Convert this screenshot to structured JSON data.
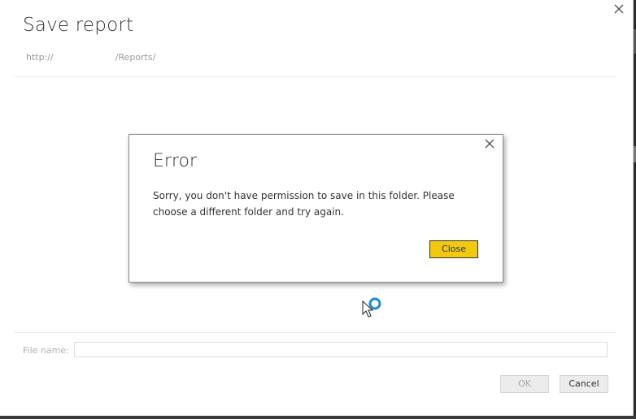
{
  "dialog": {
    "title": "Save report",
    "path_prefix": "http://",
    "path_suffix": "/Reports/",
    "close_icon": "close-icon",
    "filename_label": "File name:",
    "filename_value": "",
    "ok_label": "OK",
    "cancel_label": "Cancel"
  },
  "error": {
    "title": "Error",
    "message": "Sorry, you don't have permission to save in this folder. Please choose a different folder and try again.",
    "close_label": "Close",
    "close_icon": "close-icon",
    "accent_color": "#f2c811"
  },
  "cursor": {
    "icon": "busy-cursor-icon",
    "spinner_color": "#1e8ad6"
  }
}
